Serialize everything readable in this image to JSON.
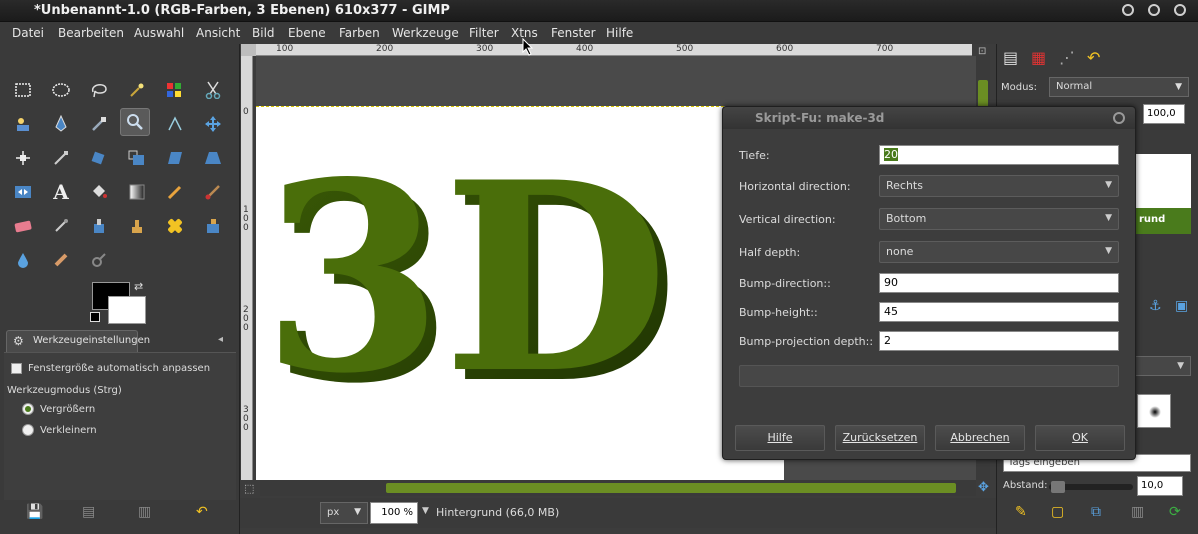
{
  "window": {
    "title": "*Unbenannt-1.0 (RGB-Farben, 3 Ebenen) 610x377 - GIMP"
  },
  "menu": [
    "Datei",
    "Bearbeiten",
    "Auswahl",
    "Ansicht",
    "Bild",
    "Ebene",
    "Farben",
    "Werkzeuge",
    "Filter",
    "Xtns",
    "Fenster",
    "Hilfe"
  ],
  "toolbox": {
    "active_tool": "zoom",
    "options_tab_label": "Werkzeugeinstellungen",
    "auto_resize_label": "Fenstergröße automatisch anpassen",
    "mode_label": "Werkzeugmodus (Strg)",
    "zoom_in_label": "Vergrößern",
    "zoom_out_label": "Verkleinern",
    "zoom_in_selected": true
  },
  "rulers": {
    "h_ticks": [
      "100",
      "200",
      "300",
      "400",
      "500",
      "600",
      "700"
    ],
    "v_ticks": [
      "0",
      "1\n0\n0",
      "2\n0\n0",
      "3\n0\n0"
    ]
  },
  "canvas": {
    "artwork_text": "3D",
    "artwork_color": "#4a6e0a"
  },
  "statusbar": {
    "unit": "px",
    "zoom": "100 %",
    "layer_info": "Hintergrund (66,0 MB)"
  },
  "dock": {
    "mode_label": "Modus:",
    "mode_value": "Normal",
    "opacity_value": "100,0",
    "selected_layer_label": "rund",
    "tags_placeholder": "Tags eingeben",
    "spacing_label": "Abstand:",
    "spacing_value": "10,0"
  },
  "dialog": {
    "title": "Skript-Fu: make-3d",
    "fields": {
      "depth_label": "Tiefe:",
      "depth_value": "20",
      "hdir_label": "Horizontal direction:",
      "hdir_value": "Rechts",
      "vdir_label": "Vertical direction:",
      "vdir_value": "Bottom",
      "half_label": "Half depth:",
      "half_value": "none",
      "bump_dir_label": "Bump-direction::",
      "bump_dir_value": "90",
      "bump_height_label": "Bump-height::",
      "bump_height_value": "45",
      "bump_proj_label": "Bump-projection depth::",
      "bump_proj_value": "2"
    },
    "buttons": {
      "help": "Hilfe",
      "reset": "Zurücksetzen",
      "cancel": "Abbrechen",
      "ok": "OK"
    }
  },
  "colors": {
    "accent": "#4a7b1c",
    "foreground": "#000000",
    "background": "#ffffff"
  }
}
